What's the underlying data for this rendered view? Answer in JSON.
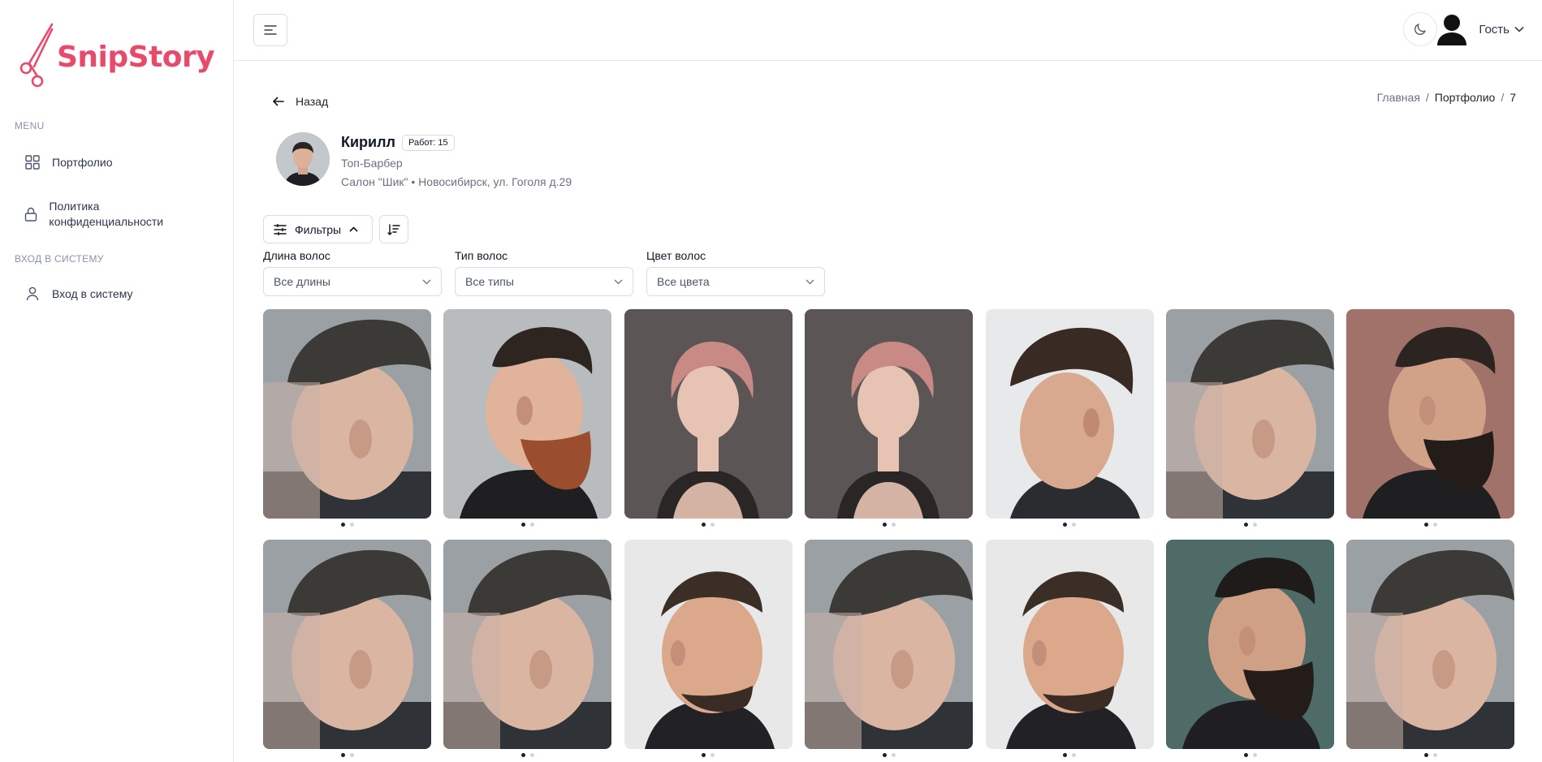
{
  "app": {
    "brand": "SnipStory",
    "brand_color": "#e84a6b"
  },
  "sidebar": {
    "menu_label": "MENU",
    "items": [
      {
        "label": "Портфолио",
        "icon": "grid-icon"
      },
      {
        "label": "Политика конфиденциальности",
        "icon": "lock-icon"
      }
    ],
    "auth_label": "ВХОД В СИСТЕМУ",
    "login_item": {
      "label": "Вход в систему",
      "icon": "user-icon"
    }
  },
  "header": {
    "user_name": "Гость"
  },
  "main": {
    "back_label": "Назад",
    "breadcrumb": [
      "Главная",
      "/",
      "Портфолио",
      "/",
      "7"
    ],
    "profile": {
      "name": "Кирилл",
      "works_badge": "Работ: 15",
      "role": "Топ-Барбер",
      "salon": "Салон \"Шик\" • Новосибирск, ул. Гоголя д.29"
    },
    "filters_label": "Фильтры",
    "filters": [
      {
        "label": "Длина волос",
        "value": "Все длины"
      },
      {
        "label": "Тип волос",
        "value": "Все типы"
      },
      {
        "label": "Цвет волос",
        "value": "Все цвета"
      }
    ],
    "gallery": [
      {
        "kind": "fade-side",
        "bg": "#9aa0a4",
        "hair": "#3c3a37",
        "skin": "#d9b5a2"
      },
      {
        "kind": "beard-red",
        "bg": "#b8bcbf",
        "hair": "#2f2520",
        "skin": "#e0b39a"
      },
      {
        "kind": "pink-woman",
        "bg": "#5b5655",
        "hair": "#c98a86",
        "skin": "#e7c3b4"
      },
      {
        "kind": "pink-woman",
        "bg": "#5b5655",
        "hair": "#c98a86",
        "skin": "#e7c3b4"
      },
      {
        "kind": "pompadour",
        "bg": "#e7e9ea",
        "hair": "#3a2a24",
        "skin": "#d8a98e"
      },
      {
        "kind": "fade-side",
        "bg": "#9aa0a4",
        "hair": "#3c3a37",
        "skin": "#d9b5a2"
      },
      {
        "kind": "beard-dark",
        "bg": "#a0726a",
        "hair": "#2b2420",
        "skin": "#d2a288"
      },
      {
        "kind": "fade-side",
        "bg": "#9aa0a4",
        "hair": "#3c3a37",
        "skin": "#d9b5a2"
      },
      {
        "kind": "fade-side",
        "bg": "#9aa0a4",
        "hair": "#3c3a37",
        "skin": "#d9b5a2"
      },
      {
        "kind": "crop",
        "bg": "#e8e8e8",
        "hair": "#3b2e27",
        "skin": "#dba88c"
      },
      {
        "kind": "fade-side",
        "bg": "#9aa0a4",
        "hair": "#3c3a37",
        "skin": "#d9b5a2"
      },
      {
        "kind": "crop",
        "bg": "#e8e8e8",
        "hair": "#3b2e27",
        "skin": "#dba88c"
      },
      {
        "kind": "curly-beard",
        "bg": "#4f6b67",
        "hair": "#1e1b19",
        "skin": "#cf9f86"
      },
      {
        "kind": "fade-side",
        "bg": "#9aa0a4",
        "hair": "#3c3a37",
        "skin": "#d9b5a2"
      }
    ]
  }
}
